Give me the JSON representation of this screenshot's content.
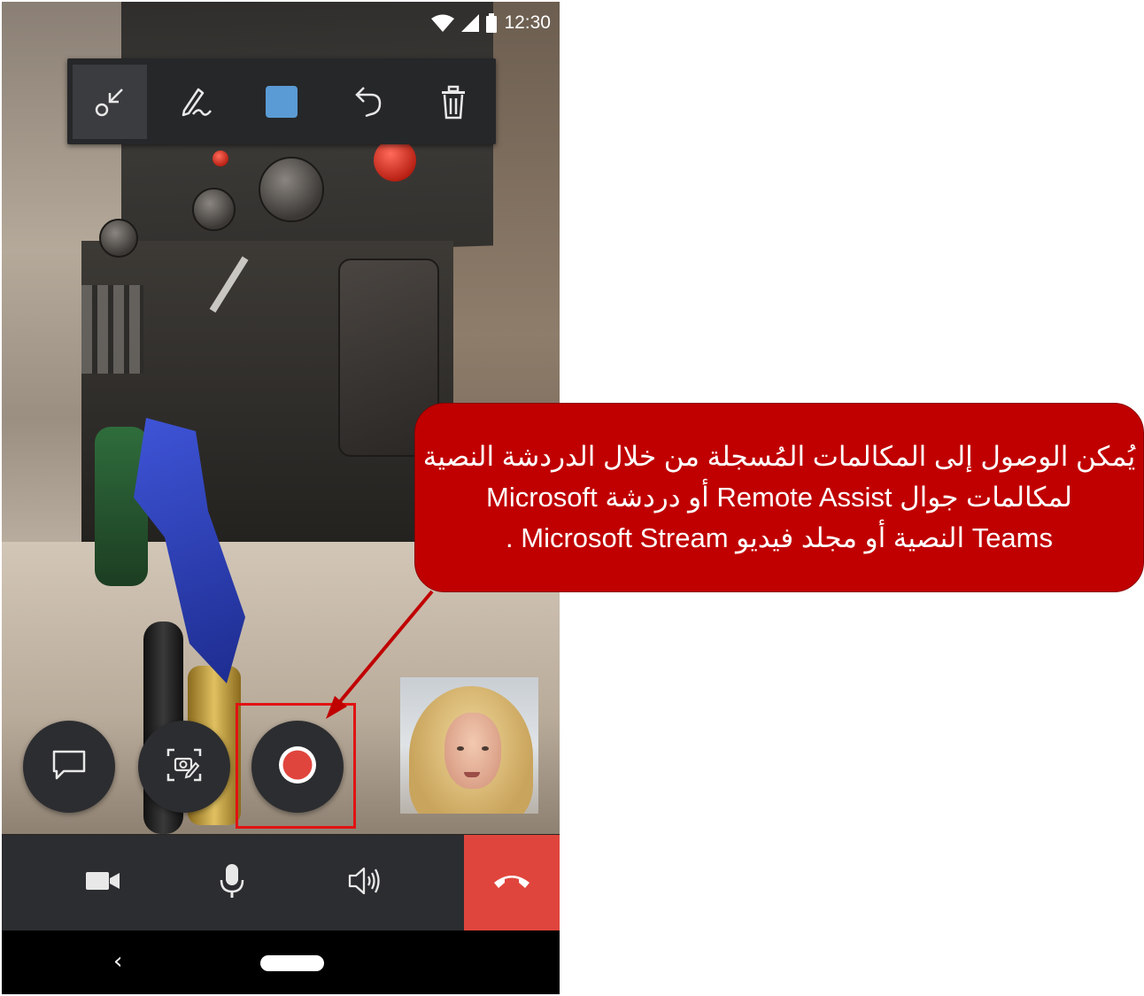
{
  "status_bar": {
    "time": "12:30",
    "icons": [
      "wifi-icon",
      "cellular-icon",
      "battery-icon"
    ]
  },
  "annotation_toolbar": {
    "tools": [
      {
        "name": "arrow-tool",
        "icon": "arrow-icon",
        "active": true
      },
      {
        "name": "ink-tool",
        "icon": "pen-icon",
        "active": false
      },
      {
        "name": "color-picker",
        "icon": "color-swatch-icon",
        "color": "#5b9bd5",
        "active": false
      },
      {
        "name": "undo",
        "icon": "undo-icon",
        "active": false
      },
      {
        "name": "clear-all",
        "icon": "trash-icon",
        "active": false
      }
    ]
  },
  "actions": [
    {
      "name": "chat",
      "icon": "chat-icon"
    },
    {
      "name": "snapshot",
      "icon": "snapshot-icon"
    },
    {
      "name": "record",
      "icon": "record-icon",
      "color": "#e0453d",
      "highlighted": true
    }
  ],
  "self_view": {
    "icon": "participant-video"
  },
  "call_controls": [
    {
      "name": "video",
      "icon": "video-camera-icon"
    },
    {
      "name": "mute",
      "icon": "microphone-icon"
    },
    {
      "name": "speaker",
      "icon": "speaker-icon"
    },
    {
      "name": "end-call",
      "icon": "hang-up-icon",
      "color": "#e0453d"
    }
  ],
  "nav_bar": {
    "back_glyph": "‹",
    "icons": [
      "back-icon",
      "home-pill-icon"
    ]
  },
  "callout": {
    "color": "#c00000",
    "lines": [
      "يُمكن الوصول إلى المكالمات المُسجلة من خلال الدردشة النصية",
      "لمكالمات جوال Remote Assist أو دردشة  Microsoft",
      "Teams النصية أو مجلد فيديو Microsoft Stream ."
    ]
  }
}
